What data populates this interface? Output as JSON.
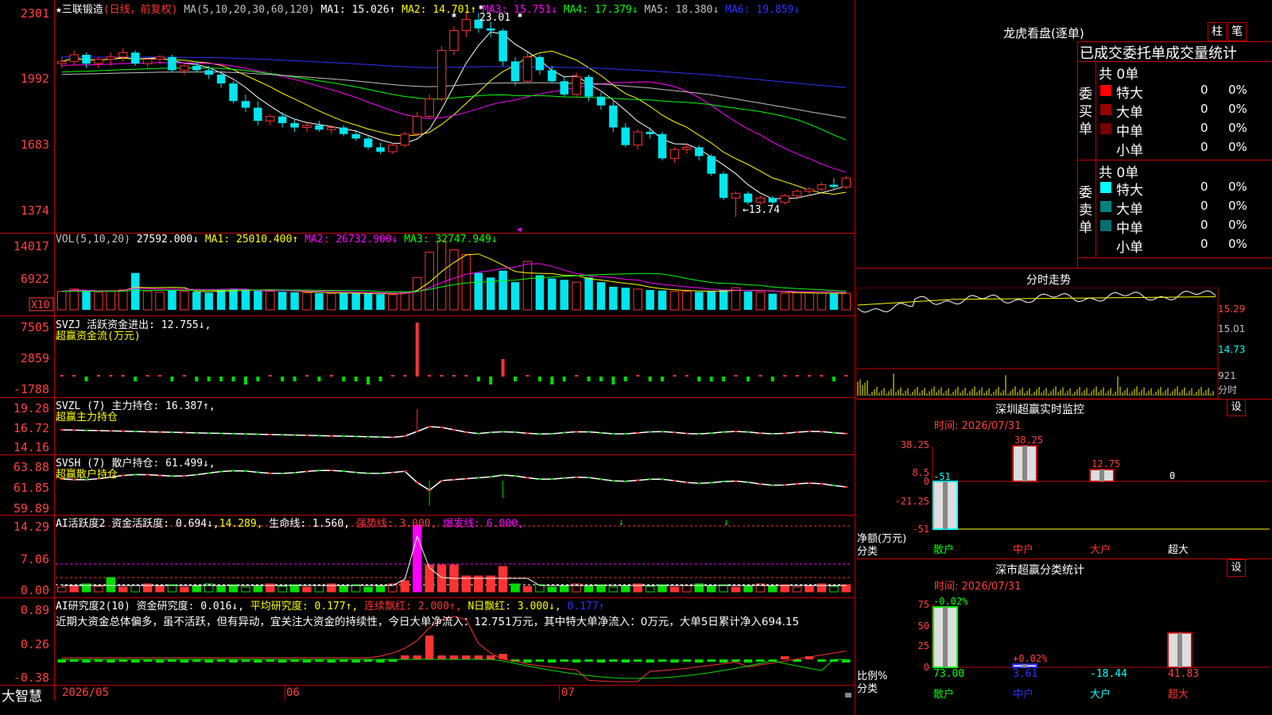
{
  "colors": {
    "up": "#ff3333",
    "down": "#00e5ee",
    "border": "#c00000",
    "axis_text": "#ff4040",
    "ma1": "#ffffff",
    "ma2": "#ffff00",
    "ma3": "#ff00ff",
    "ma4": "#00ff00",
    "ma5": "#c0c0c0",
    "ma6": "#3030ff",
    "green_bar": "#00dd00",
    "magenta": "#ff00ff"
  },
  "main": {
    "star": "★",
    "stock_name": "三联锻造",
    "period_label": "(日线，前复权)",
    "ma_label": "MA(5,10,20,30,60,120)",
    "ma1": "MA1: 15.026↑",
    "ma2": "MA2: 14.701↑",
    "ma3": "MA3: 15.751↓",
    "ma4": "MA4: 17.379↓",
    "ma5": "MA5: 18.380↓",
    "ma6": "MA6: 19.859↓",
    "y_ticks": [
      "2301",
      "1992",
      "1683",
      "1374"
    ],
    "high_marker": "23.01",
    "low_marker": "←13.74"
  },
  "vol": {
    "label": "VOL(5,10,20)",
    "value": "27592.000↓",
    "ma1": "MA1: 25010.400↑",
    "ma2": "MA2: 26732.900↓",
    "ma3": "MA3: 32747.949↓",
    "y_ticks": [
      "14017",
      "6922"
    ],
    "unit": "X10"
  },
  "svzj": {
    "label": "SVZJ  活跃资金进出: 12.755↓,",
    "sub": "超赢资金流(万元)",
    "y_ticks": [
      "7505",
      "2859",
      "-1788"
    ]
  },
  "svzl": {
    "label": "SVZL (7) 主力持仓: 16.387↑,",
    "sub": "超赢主力持仓",
    "y_ticks": [
      "19.28",
      "16.72",
      "14.16"
    ]
  },
  "svsh": {
    "label": "SVSH (7) 散户持仓: 61.499↓,",
    "sub": "超赢散户持仓",
    "y_ticks": [
      "63.88",
      "61.85",
      "59.89"
    ]
  },
  "ai_active": {
    "label": "AI活跃度2 资金活跃度: 0.694↓,",
    "v2": "14.289,",
    "v3": "生命线: 1.560,",
    "v4": "强势线: 3.000,",
    "v5": "爆发线: 6.000,",
    "y_ticks": [
      "14.29",
      "7.06",
      "0.00"
    ]
  },
  "ai_research": {
    "label": "AI研究度2(10) 资金研究度: 0.016↓,",
    "v2": "平均研究度: 0.177↑,",
    "v3": "连续飘红: 2.000↑,",
    "v4": "N日飘红: 3.000↓,",
    "v5": "0.177↑",
    "commentary": "近期大资金总体偏多，虽不活跃，但有异动，宜关注大资金的持续性，今日大单净流入：12.751万元，其中特大单净流入：0万元，大单5日累计净入694.15",
    "y_ticks": [
      "0.89",
      "0.26",
      "-0.38"
    ]
  },
  "bottom": {
    "brand": "大智慧",
    "dates": [
      "2026/05",
      "06",
      "07"
    ]
  },
  "right": {
    "lhb_title": "龙虎看盘(逐单)",
    "btn_zhu": "柱",
    "btn_bi": "笔",
    "header": "已成交委托单成交量统计",
    "buy_side_label": "委买单",
    "sell_side_label": "委卖单",
    "buy_total": "共 0单",
    "sell_total": "共 0单",
    "buy_rows": [
      {
        "name": "特大",
        "count": "0",
        "pct": "0%",
        "color": "#ff0000"
      },
      {
        "name": "大单",
        "count": "0",
        "pct": "0%",
        "color": "#990000"
      },
      {
        "name": "中单",
        "count": "0",
        "pct": "0%",
        "color": "#770000"
      },
      {
        "name": "小单",
        "count": "0",
        "pct": "0%",
        "color": ""
      }
    ],
    "sell_rows": [
      {
        "name": "特大",
        "count": "0",
        "pct": "0%",
        "color": "#00ffff"
      },
      {
        "name": "大单",
        "count": "0",
        "pct": "0%",
        "color": "#008080"
      },
      {
        "name": "中单",
        "count": "0",
        "pct": "0%",
        "color": "#007070"
      },
      {
        "name": "小单",
        "count": "0",
        "pct": "0%",
        "color": ""
      }
    ],
    "intraday_title": "分时走势",
    "intraday_ticks": [
      "15.29",
      "15.01",
      "14.73",
      "921",
      "分时"
    ],
    "sz_title": "深圳超赢实时监控",
    "sz_btn": "设",
    "sz_time": "时间: 2026/07/31",
    "sz_yticks": [
      "38.25",
      "8.5",
      "0",
      "-21.25",
      "-51"
    ],
    "sz_ylabel1": "净额(万元)",
    "sz_ylabel2": "分类",
    "sz_cats": [
      "散户",
      "中户",
      "大户",
      "超大"
    ],
    "sz_values": [
      -51,
      38.25,
      12.75,
      0
    ],
    "sz_value_labels": [
      "-51",
      "38.25",
      "12.75",
      "0"
    ],
    "ss_title": "深市超赢分类统计",
    "ss_btn": "设",
    "ss_time": "时间: 2026/07/31",
    "ss_yticks": [
      "75",
      "50",
      "25",
      "0"
    ],
    "ss_top_labels": [
      "-0.02%",
      "+0.02%",
      "",
      ""
    ],
    "ss_ylabel1": "比例%",
    "ss_ylabel2": "分类",
    "ss_cats": [
      "散户",
      "中户",
      "大户",
      "超大"
    ],
    "ss_values": [
      "73.00",
      "3.61",
      "-18.44",
      "41.83"
    ],
    "ss_heights": [
      73.0,
      3.61,
      0,
      41.83
    ]
  },
  "chart_data": {
    "type": "candlestick",
    "candles": [
      [
        20.7,
        21.0,
        20.5,
        20.8
      ],
      [
        20.8,
        21.3,
        20.6,
        21.1
      ],
      [
        21.1,
        21.2,
        20.5,
        20.7
      ],
      [
        20.7,
        21.0,
        20.5,
        20.9
      ],
      [
        20.9,
        21.2,
        20.6,
        21.0
      ],
      [
        21.0,
        21.4,
        20.8,
        21.2
      ],
      [
        21.2,
        21.3,
        20.6,
        20.7
      ],
      [
        20.7,
        21.0,
        20.5,
        20.9
      ],
      [
        20.9,
        21.1,
        20.7,
        21.0
      ],
      [
        21.0,
        21.1,
        20.3,
        20.4
      ],
      [
        20.4,
        20.7,
        20.2,
        20.6
      ],
      [
        20.6,
        20.8,
        20.3,
        20.4
      ],
      [
        20.4,
        20.6,
        20.0,
        20.2
      ],
      [
        20.2,
        20.4,
        19.6,
        19.8
      ],
      [
        19.8,
        19.9,
        18.9,
        19.0
      ],
      [
        19.0,
        19.3,
        18.5,
        18.7
      ],
      [
        18.7,
        19.0,
        17.9,
        18.1
      ],
      [
        18.1,
        18.4,
        17.9,
        18.3
      ],
      [
        18.3,
        18.5,
        17.8,
        18.0
      ],
      [
        18.0,
        18.2,
        17.6,
        17.8
      ],
      [
        17.8,
        18.0,
        17.6,
        17.9
      ],
      [
        17.9,
        18.1,
        17.6,
        17.7
      ],
      [
        17.7,
        17.9,
        17.5,
        17.8
      ],
      [
        17.8,
        17.9,
        17.4,
        17.5
      ],
      [
        17.5,
        17.7,
        17.2,
        17.3
      ],
      [
        17.3,
        17.4,
        16.8,
        16.9
      ],
      [
        16.9,
        17.1,
        16.6,
        16.7
      ],
      [
        16.7,
        17.1,
        16.6,
        17.0
      ],
      [
        17.0,
        17.6,
        16.9,
        17.5
      ],
      [
        17.5,
        18.5,
        17.4,
        18.3
      ],
      [
        18.3,
        19.3,
        18.2,
        19.1
      ],
      [
        19.1,
        21.5,
        19.0,
        21.3
      ],
      [
        21.3,
        22.4,
        21.1,
        22.2
      ],
      [
        22.2,
        23.01,
        21.9,
        22.7
      ],
      [
        22.7,
        23.0,
        22.1,
        22.3
      ],
      [
        22.3,
        22.6,
        21.9,
        22.2
      ],
      [
        22.2,
        22.3,
        20.6,
        20.8
      ],
      [
        20.8,
        21.0,
        19.7,
        19.9
      ],
      [
        19.9,
        21.2,
        19.8,
        21.0
      ],
      [
        21.0,
        21.1,
        20.2,
        20.4
      ],
      [
        20.4,
        20.6,
        19.8,
        19.9
      ],
      [
        19.9,
        20.1,
        19.2,
        19.3
      ],
      [
        19.3,
        20.3,
        19.2,
        20.1
      ],
      [
        20.1,
        20.2,
        19.0,
        19.2
      ],
      [
        19.2,
        19.4,
        18.6,
        18.8
      ],
      [
        18.8,
        19.0,
        17.6,
        17.8
      ],
      [
        17.8,
        18.0,
        16.9,
        17.0
      ],
      [
        17.0,
        17.7,
        16.8,
        17.6
      ],
      [
        17.6,
        17.8,
        17.3,
        17.5
      ],
      [
        17.5,
        17.6,
        16.3,
        16.4
      ],
      [
        16.4,
        16.9,
        16.2,
        16.8
      ],
      [
        16.8,
        17.1,
        16.6,
        16.9
      ],
      [
        16.9,
        17.0,
        16.3,
        16.5
      ],
      [
        16.5,
        16.6,
        15.6,
        15.7
      ],
      [
        15.7,
        15.8,
        14.5,
        14.6
      ],
      [
        14.6,
        14.9,
        13.74,
        14.8
      ],
      [
        14.8,
        14.9,
        14.3,
        14.4
      ],
      [
        14.4,
        14.7,
        14.3,
        14.6
      ],
      [
        14.6,
        14.7,
        14.3,
        14.4
      ],
      [
        14.4,
        14.8,
        14.3,
        14.7
      ],
      [
        14.7,
        15.0,
        14.6,
        14.9
      ],
      [
        14.9,
        15.1,
        14.7,
        15.0
      ],
      [
        15.0,
        15.3,
        14.9,
        15.2
      ],
      [
        15.2,
        15.5,
        15.0,
        15.1
      ],
      [
        15.1,
        15.6,
        15.0,
        15.5
      ]
    ],
    "volumes": [
      4000,
      4500,
      4200,
      3800,
      4000,
      4300,
      8000,
      4000,
      3800,
      4200,
      4000,
      3900,
      3700,
      4500,
      4600,
      4400,
      4300,
      4000,
      3900,
      3800,
      3700,
      3600,
      3500,
      3700,
      3600,
      3500,
      3400,
      3300,
      3800,
      7000,
      12500,
      15000,
      13000,
      12000,
      8000,
      7000,
      8500,
      6000,
      10500,
      7500,
      6800,
      6500,
      6000,
      7000,
      6000,
      5000,
      4800,
      4500,
      4300,
      4200,
      4000,
      4000,
      3900,
      4100,
      4300,
      4800,
      4000,
      3800,
      3500,
      3600,
      3700,
      3700,
      3600,
      3500,
      3600
    ],
    "ylim_price": [
      13.2,
      23.3
    ],
    "ylim_volume": [
      0,
      15500
    ]
  }
}
